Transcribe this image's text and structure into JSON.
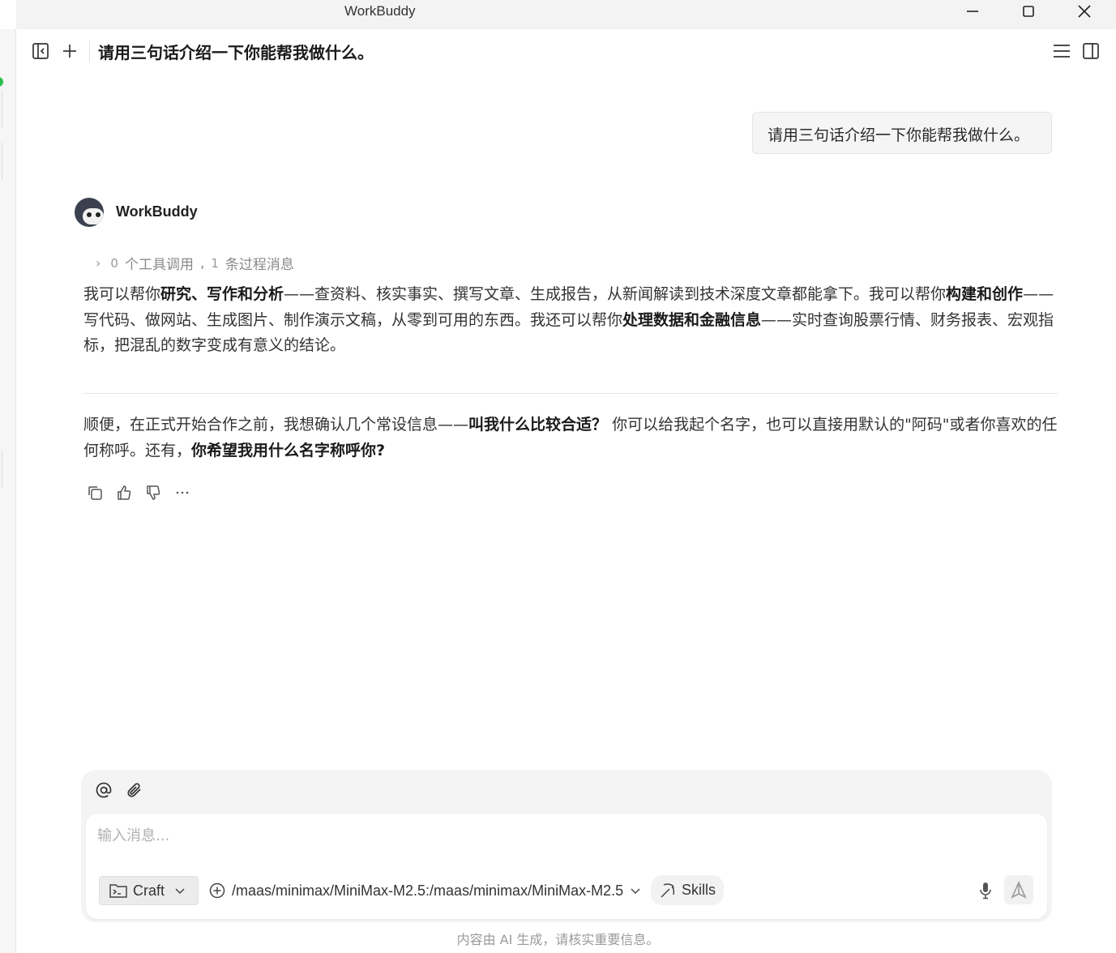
{
  "window": {
    "title": "WorkBuddy",
    "minimize_label": "",
    "maximize_label": "",
    "close_label": ""
  },
  "header": {
    "conversation_title": "请用三句话介绍一下你能帮我做什么。"
  },
  "user_message": {
    "text": "请用三句话介绍一下你能帮我做什么。"
  },
  "assistant": {
    "name": "WorkBuddy",
    "tool_summary": {
      "tool_calls_count": "0",
      "tool_calls_label": "个工具调用",
      "separator": ",",
      "process_count": "1",
      "process_label": "条过程消息"
    },
    "paragraph1": [
      {
        "t": "我可以帮你",
        "b": false
      },
      {
        "t": "研究、写作和分析",
        "b": true
      },
      {
        "t": "——查资料、核实事实、撰写文章、生成报告，从新闻解读到技术深度文章都能拿下。我可以帮你",
        "b": false
      },
      {
        "t": "构建和创作",
        "b": true
      },
      {
        "t": "——写代码、做网站、生成图片、制作演示文稿，从零到可用的东西。我还可以帮你",
        "b": false
      },
      {
        "t": "处理数据和金融信息",
        "b": true
      },
      {
        "t": "——实时查询股票行情、财务报表、宏观指标，把混乱的数字变成有意义的结论。",
        "b": false
      }
    ],
    "paragraph2": [
      {
        "t": "顺便，在正式开始合作之前，我想确认几个常设信息——",
        "b": false
      },
      {
        "t": "叫我什么比较合适？",
        "b": true
      },
      {
        "t": " 你可以给我起个名字，也可以直接用默认的\"阿码\"或者你喜欢的任何称呼。还有，",
        "b": false
      },
      {
        "t": "你希望我用什么名字称呼你?",
        "b": true
      }
    ]
  },
  "composer": {
    "placeholder": "输入消息...",
    "mode_label": "Craft",
    "model_label": "/maas/minimax/MiniMax-M2.5:/maas/minimax/MiniMax-M2.5",
    "skills_label": "Skills"
  },
  "footer": {
    "disclaimer": "内容由 AI 生成，请核实重要信息。"
  },
  "colors": {
    "status_dot": "#2dbf4e",
    "bubble_bg": "#f5f5f5",
    "composer_bg": "#f4f4f4"
  }
}
